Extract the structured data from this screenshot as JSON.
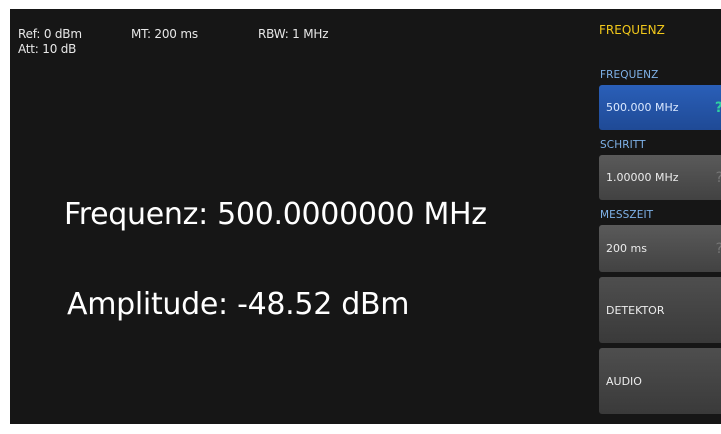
{
  "status": {
    "ref": "Ref: 0 dBm",
    "att": "Att: 10 dB",
    "mt": "MT: 200 ms",
    "rbw": "RBW: 1 MHz"
  },
  "readout": {
    "frequency": "Frequenz: 500.0000000 MHz",
    "amplitude": "Amplitude: -48.52 dBm"
  },
  "menu": {
    "title": "FREQUENZ",
    "frequency_label": "FREQUENZ",
    "frequency_value": "500.000 MHz",
    "step_label": "SCHRITT",
    "step_value": "1.00000 MHz",
    "measure_time_label": "MESSZEIT",
    "measure_time_value": "200 ms",
    "detector_label": "DETEKTOR",
    "audio_label": "AUDIO"
  },
  "colors": {
    "background": "#161616",
    "menu_title": "#f2c81a",
    "section_label": "#7fb2e8",
    "active_button": "#2a5fb8",
    "button": "#4e4e4e",
    "knob_indicator": "#2fd0a0"
  },
  "icons": {
    "frequency_knob": "knob-indicator-icon",
    "step_knob": "knob-indicator-icon",
    "measure_time_knob": "knob-indicator-icon"
  }
}
